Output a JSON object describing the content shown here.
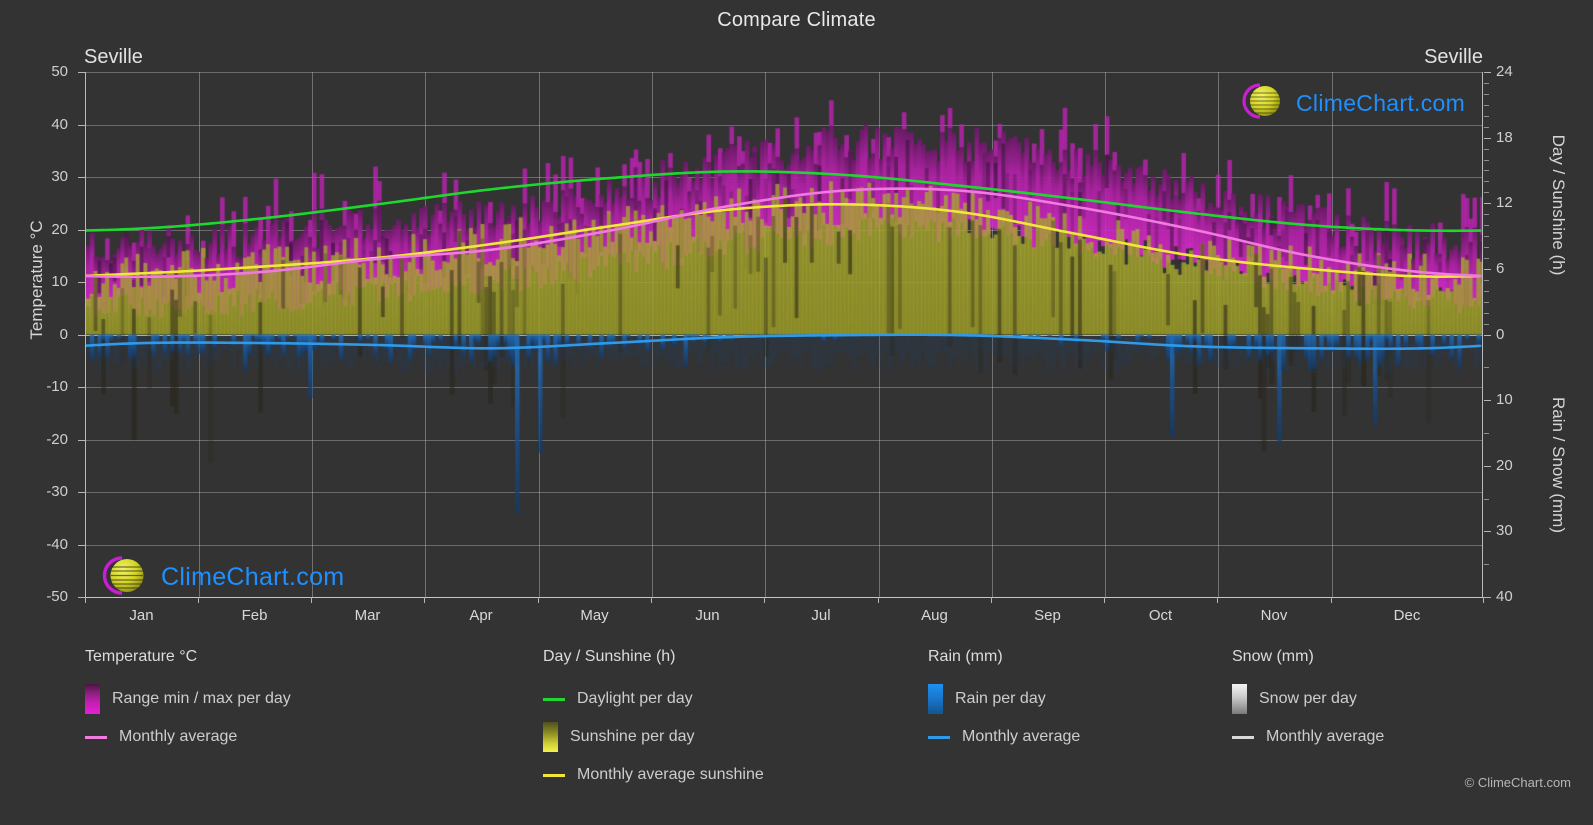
{
  "header": {
    "title": "Compare Climate",
    "city_left": "Seville",
    "city_right": "Seville"
  },
  "footer": {
    "copyright": "© ClimeChart.com"
  },
  "watermark": {
    "text": "ClimeChart.com",
    "logo_arc_color": "#c81fd2",
    "logo_sphere_color": "#d4d427",
    "text_color": "#1e90ff"
  },
  "axes": {
    "left_title": "Temperature °C",
    "left_ticks": [
      "50",
      "40",
      "30",
      "20",
      "10",
      "0",
      "-10",
      "-20",
      "-30",
      "-40",
      "-50"
    ],
    "left_values": [
      50,
      40,
      30,
      20,
      10,
      0,
      -10,
      -20,
      -30,
      -40,
      -50
    ],
    "right_top_title": "Day / Sunshine (h)",
    "right_top_ticks": [
      "24",
      "18",
      "12",
      "6",
      "0"
    ],
    "right_top_values": [
      24,
      18,
      12,
      6,
      0
    ],
    "right_bottom_title": "Rain / Snow (mm)",
    "right_bottom_ticks": [
      "0",
      "10",
      "20",
      "30",
      "40"
    ],
    "right_bottom_values": [
      0,
      10,
      20,
      30,
      40
    ]
  },
  "legend": {
    "temperature": {
      "heading": "Temperature °C",
      "items": [
        {
          "label": "Range min / max per day",
          "marker": "gradient-swatch",
          "color": "#e61fd2"
        },
        {
          "label": "Monthly average",
          "marker": "line",
          "color": "#f07ae0"
        }
      ]
    },
    "day_sunshine": {
      "heading": "Day / Sunshine (h)",
      "items": [
        {
          "label": "Daylight per day",
          "marker": "line",
          "color": "#1fd82f"
        },
        {
          "label": "Sunshine per day",
          "marker": "gradient-swatch",
          "color": "#f2f24a"
        },
        {
          "label": "Monthly average sunshine",
          "marker": "line",
          "color": "#f0e63c"
        }
      ]
    },
    "rain": {
      "heading": "Rain (mm)",
      "items": [
        {
          "label": "Rain per day",
          "marker": "gradient-swatch",
          "color": "#1f90f0"
        },
        {
          "label": "Monthly average",
          "marker": "line",
          "color": "#2f9be8"
        }
      ]
    },
    "snow": {
      "heading": "Snow (mm)",
      "items": [
        {
          "label": "Snow per day",
          "marker": "gradient-swatch",
          "color": "#e8e8e8"
        },
        {
          "label": "Monthly average",
          "marker": "line",
          "color": "#d8d8d8"
        }
      ]
    }
  },
  "chart_data": {
    "type": "line",
    "title": "Compare Climate",
    "subtitle": "Seville",
    "xlabel": "",
    "ylabel": "Temperature °C",
    "ylim": [
      -50,
      50
    ],
    "y2lim_day": [
      0,
      24
    ],
    "y2lim_rain": [
      0,
      40
    ],
    "grid": true,
    "legend_position": "below",
    "categories": [
      "Jan",
      "Feb",
      "Mar",
      "Apr",
      "May",
      "Jun",
      "Jul",
      "Aug",
      "Sep",
      "Oct",
      "Nov",
      "Dec"
    ],
    "month_tick_x": [
      85,
      198,
      311,
      424,
      538,
      651,
      764,
      878,
      991,
      1104,
      1217,
      1331,
      1483
    ],
    "series": [
      {
        "name": "Monthly average temperature",
        "unit": "°C",
        "color": "#f07ae0",
        "axis": "left",
        "values": [
          11.0,
          11.9,
          14.4,
          16.2,
          19.8,
          24.4,
          27.4,
          27.4,
          24.3,
          20.0,
          15.0,
          11.8
        ]
      },
      {
        "name": "Daily max temperature",
        "unit": "°C",
        "color": "#c41fb4",
        "axis": "left",
        "values": [
          16.5,
          18.0,
          21.5,
          23.0,
          27.0,
          32.0,
          36.0,
          35.5,
          31.5,
          26.0,
          20.5,
          17.0
        ]
      },
      {
        "name": "Daily min temperature",
        "unit": "°C",
        "color": "#8a1f7a",
        "axis": "left",
        "values": [
          5.5,
          6.3,
          8.2,
          10.2,
          13.2,
          17.0,
          19.5,
          19.8,
          17.5,
          14.0,
          9.5,
          6.8
        ]
      },
      {
        "name": "Daylight per day",
        "unit": "h",
        "color": "#1fd82f",
        "axis": "right-top",
        "values": [
          9.7,
          10.6,
          11.9,
          13.3,
          14.3,
          14.9,
          14.6,
          13.6,
          12.4,
          11.1,
          10.0,
          9.5
        ]
      },
      {
        "name": "Monthly average sunshine",
        "unit": "h",
        "color": "#f0e63c",
        "axis": "right-top",
        "values": [
          5.6,
          6.2,
          7.0,
          8.3,
          9.9,
          11.4,
          11.9,
          11.2,
          9.2,
          7.2,
          6.0,
          5.3
        ]
      },
      {
        "name": "Monthly average rain",
        "unit": "mm",
        "color": "#2f9be8",
        "axis": "right-bottom",
        "values": [
          1.3,
          1.3,
          1.6,
          2.1,
          1.3,
          0.4,
          0.1,
          0.1,
          0.8,
          1.8,
          2.1,
          2.1
        ]
      },
      {
        "name": "Monthly average snow",
        "unit": "mm",
        "color": "#d8d8d8",
        "axis": "right-bottom",
        "values": [
          0,
          0,
          0,
          0,
          0,
          0,
          0,
          0,
          0,
          0,
          0,
          0
        ]
      }
    ]
  }
}
